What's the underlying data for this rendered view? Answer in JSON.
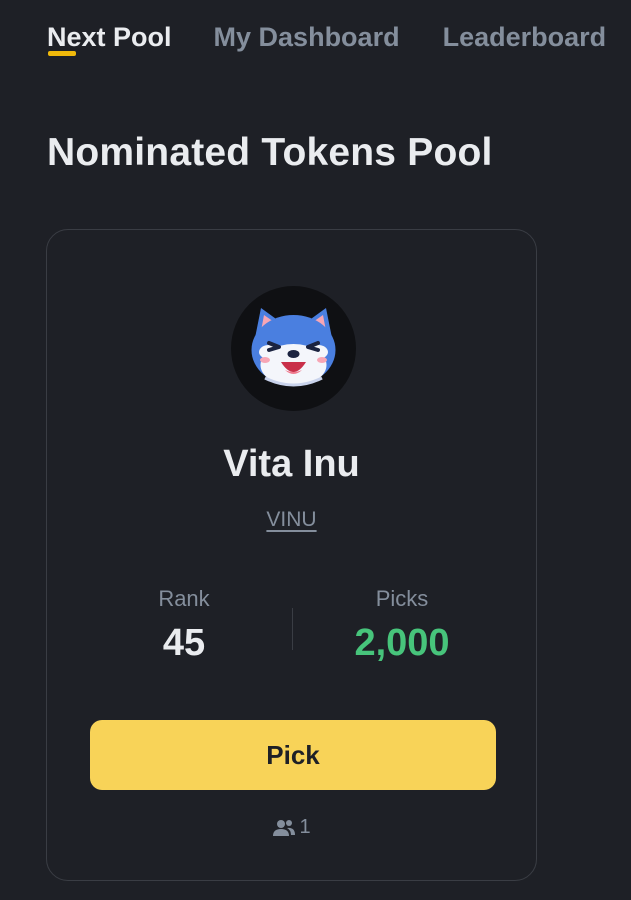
{
  "tabs": [
    {
      "label": "Next Pool",
      "active": true
    },
    {
      "label": "My Dashboard",
      "active": false
    },
    {
      "label": "Leaderboard",
      "active": false
    }
  ],
  "page_title": "Nominated Tokens Pool",
  "token": {
    "name": "Vita Inu",
    "symbol": "VINU",
    "logo_icon": "shiba-inu-dog-logo"
  },
  "stats": {
    "rank_label": "Rank",
    "rank_value": "45",
    "picks_label": "Picks",
    "picks_value": "2,000"
  },
  "pick_button_label": "Pick",
  "participants": {
    "icon": "users-icon",
    "count": "1"
  },
  "colors": {
    "background": "#1e2026",
    "accent_underline": "#f0b90b",
    "button": "#f8d358",
    "picks_green": "#47c47b",
    "muted_text": "#848e9c"
  }
}
